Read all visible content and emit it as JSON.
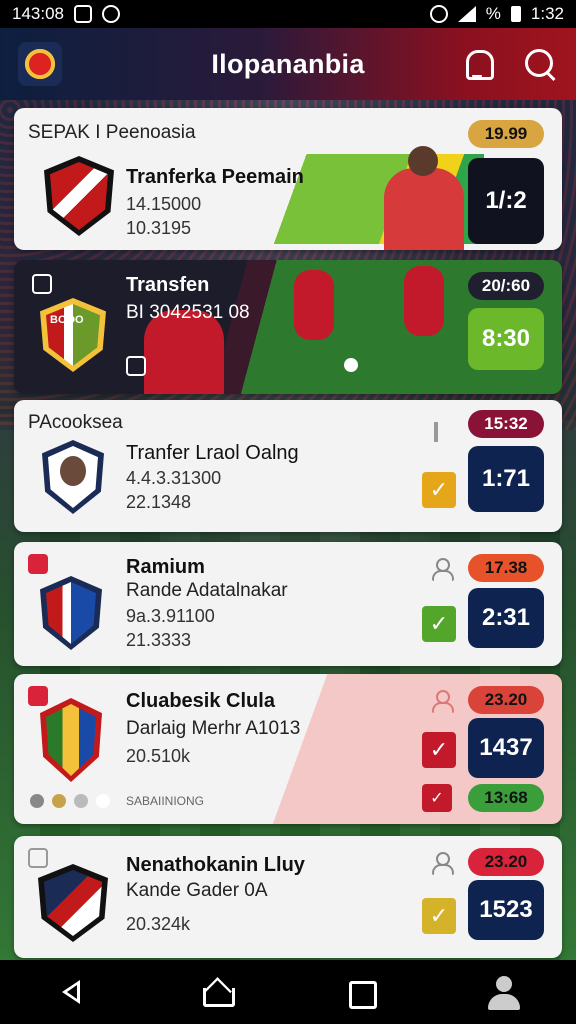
{
  "status_bar": {
    "time_left": "143:08",
    "time_right": "1:32",
    "battery_text": "%"
  },
  "header": {
    "title": "Ilopananbia"
  },
  "cards": [
    {
      "section": "SEPAK I Peenoasia",
      "title": "Tranferka Peemain",
      "line1": "14.15000",
      "line2": "10.3195",
      "pill": "19.99",
      "pill_color": "#d8a541",
      "score": "1/:2",
      "crest_colors": [
        "#c21a1a",
        "#111111",
        "#ffffff"
      ]
    },
    {
      "section": "",
      "title": "Transfen",
      "line1": "BI 3042531 08",
      "line2": "",
      "pill": "20/:60",
      "pill_color": "#1f1f30",
      "score": "8:30",
      "score_bg": "#6bb82a",
      "crest_text": "BOOO",
      "crest_colors": [
        "#c21a1a",
        "#6b9a2a",
        "#f4c23a"
      ]
    },
    {
      "section": "PAcooksea",
      "title": "Tranfer Lraol Oalng",
      "line1": "4.4.3.31300",
      "line2": "22.1348",
      "pill": "15:32",
      "pill_color": "#8a1236",
      "score": "1:71",
      "check_color": "#e5a619",
      "crest_colors": [
        "#1a2b55",
        "#c21a1a",
        "#ffffff"
      ]
    },
    {
      "section": "",
      "title": "Ramium",
      "line2_label": "Rande Adatalnakar",
      "line1": "9a.3.91100",
      "line2": "21.3333",
      "pill": "17.38",
      "pill_color": "#e8522a",
      "score": "2:31",
      "check_color": "#54a62a",
      "crest_colors": [
        "#1a4aa8",
        "#c21a1a",
        "#f4c23a"
      ]
    },
    {
      "section": "",
      "title": "Cluabesik Clula",
      "line2_label": "Darlaig Merhr A1013",
      "line1": "20.510k",
      "line2": "",
      "pill": "23.20",
      "pill_color": "#d9433a",
      "score": "1437",
      "pill2": "13:68",
      "pill2_color": "#3a9e3a",
      "check_color": "#c21a2a",
      "footer": "SABAIINIONG",
      "crest_colors": [
        "#2a7a2a",
        "#c21a1a",
        "#f4c23a"
      ]
    },
    {
      "section": "",
      "title": "Nenathokanin Lluy",
      "line2_label": "Kande Gader 0A",
      "line1": "20.324k",
      "line2": "",
      "pill": "23.20",
      "pill_color": "#d9233a",
      "score": "1523",
      "check_color": "#d4b22a",
      "crest_colors": [
        "#1a2b55",
        "#c21a1a",
        "#ffffff"
      ]
    }
  ],
  "bottom_nav": [
    "back",
    "home",
    "recents",
    "profile"
  ]
}
